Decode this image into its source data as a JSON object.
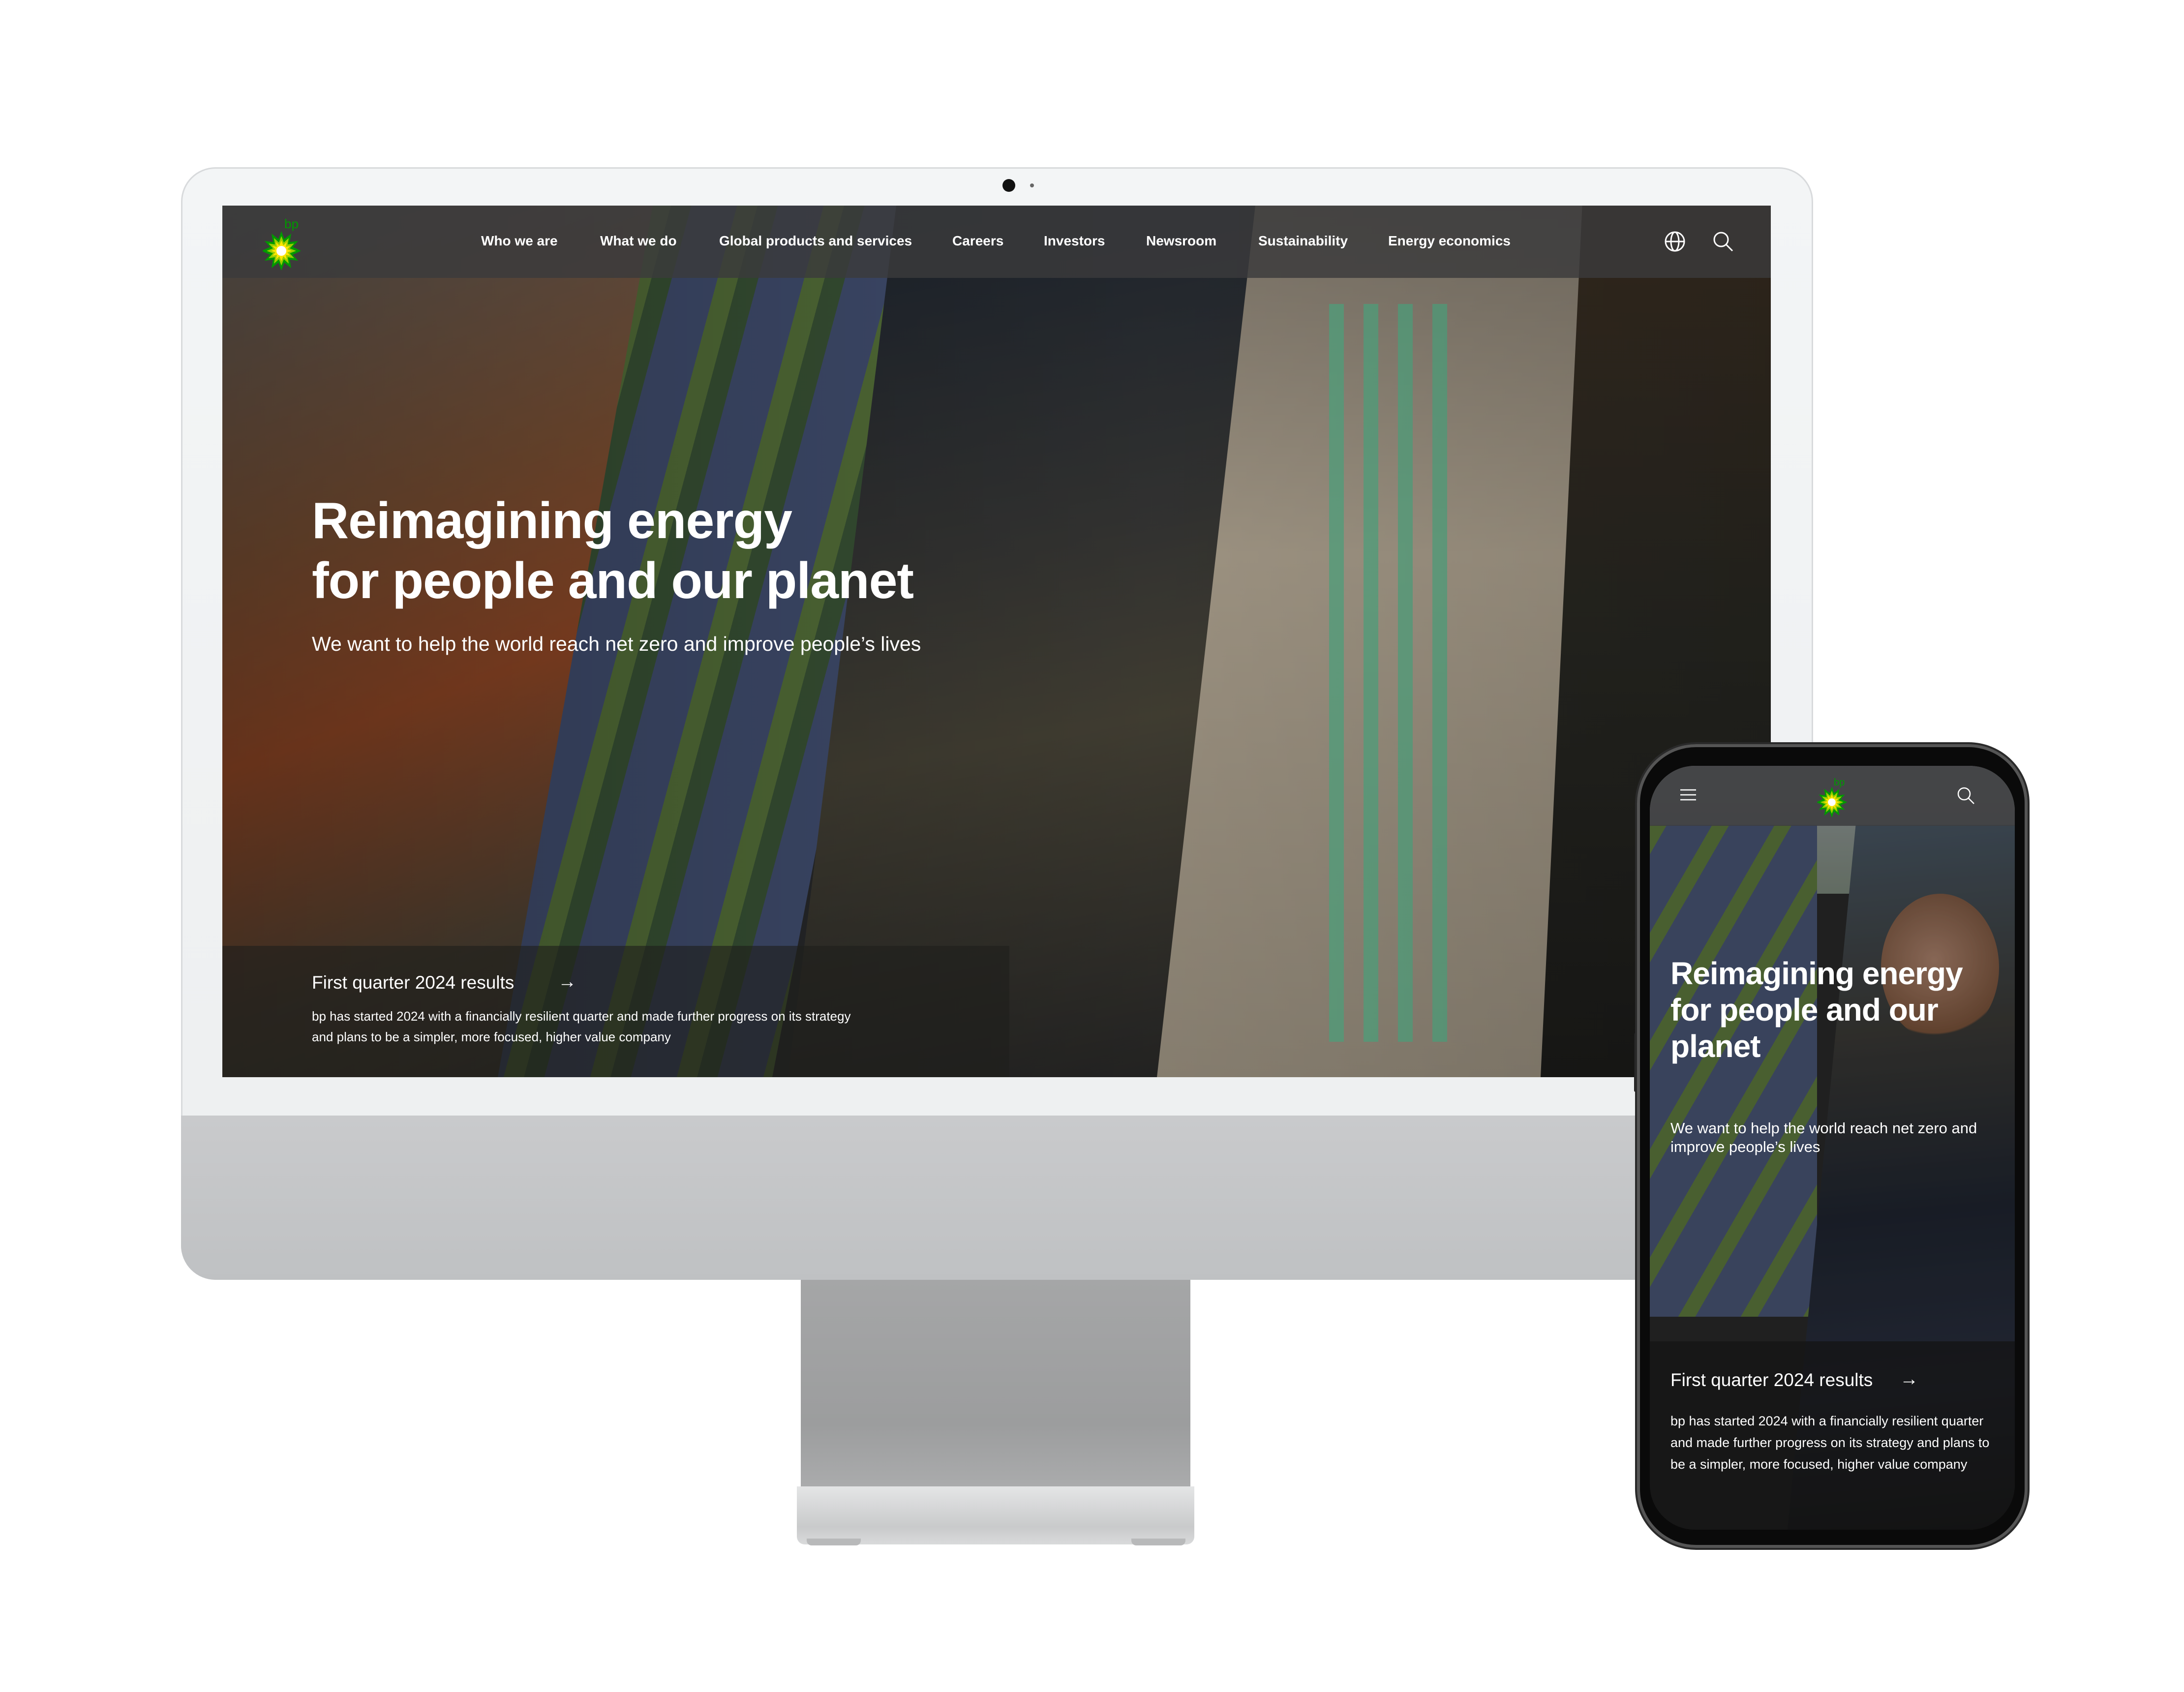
{
  "brand": {
    "logo_text": "bp",
    "logo_green": "#009900",
    "logo_yellow": "#ffe600",
    "logo_lightgreen": "#99cc00"
  },
  "desktop": {
    "nav": {
      "items": [
        {
          "label": "Who we are"
        },
        {
          "label": "What we do"
        },
        {
          "label": "Global products and services"
        },
        {
          "label": "Careers"
        },
        {
          "label": "Investors"
        },
        {
          "label": "Newsroom"
        },
        {
          "label": "Sustainability"
        },
        {
          "label": "Energy economics"
        }
      ],
      "icons": [
        "globe-icon",
        "search-icon"
      ]
    },
    "hero": {
      "title_line1": "Reimagining energy",
      "title_line2": "for people and our planet",
      "subtitle": "We want to help the world reach net zero and improve people’s lives"
    },
    "feature_card": {
      "title": "First quarter 2024 results",
      "arrow": "→",
      "body": "bp has started 2024 with a financially resilient quarter and made further progress on its strategy and plans to be a simpler, more focused, higher value company"
    }
  },
  "mobile": {
    "nav": {
      "icons": [
        "menu-icon",
        "search-icon"
      ]
    },
    "hero": {
      "title": "Reimagining energy for people and our planet",
      "subtitle": "We want to help the world reach net zero and improve people’s lives"
    },
    "feature_card": {
      "title": "First quarter 2024 results",
      "arrow": "→",
      "body": "bp has started 2024 with a financially resilient quarter and made further progress on its strategy and plans to be a simpler, more focused, higher value company"
    }
  }
}
